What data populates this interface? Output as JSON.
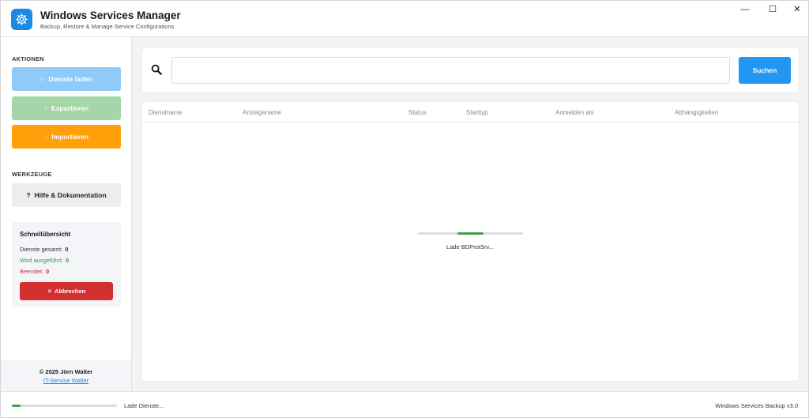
{
  "app": {
    "title": "Windows Services Manager",
    "subtitle": "Backup, Restore & Manage Service Configurations",
    "accent_color": "#1e88e5",
    "icon": "gear-icon"
  },
  "window_controls": {
    "minimize": "—",
    "maximize": "☐",
    "close": "✕"
  },
  "sidebar": {
    "actions_title": "AKTIONEN",
    "actions": [
      {
        "icon": "○",
        "label": "Dienste laden",
        "color": "#90caf9"
      },
      {
        "icon": "↑",
        "label": "Exportieren",
        "color": "#a5d6a7"
      },
      {
        "icon": "↓",
        "label": "Importieren",
        "color": "#ff9f0a"
      }
    ],
    "tools_title": "WERKZEUGE",
    "help": {
      "icon": "?",
      "label": "Hilfe & Dokumentation"
    },
    "summary": {
      "title": "Schnellübersicht",
      "total_label": "Dienste gesamt:",
      "total_value": "0",
      "running_label": "Wird ausgeführt:",
      "running_value": "0",
      "stopped_label": "Beendet:",
      "stopped_value": "0",
      "running_color": "#2e9e3e",
      "stopped_color": "#d32f2f",
      "cancel_icon": "✕",
      "cancel_label": "Abbrechen"
    },
    "footer": {
      "copyright": "© 2025 Jörn Walter",
      "link": "IT-Service Walter"
    }
  },
  "search": {
    "placeholder": "",
    "value": "",
    "button_label": "Suchen"
  },
  "table": {
    "columns": [
      "Dienstname",
      "Anzeigename",
      "Status",
      "Starttyp",
      "Anmelden als",
      "Abhängigkeiten"
    ],
    "rows": [],
    "loading_text": "Lade BDProtSrv...",
    "loading_progress": 0.25
  },
  "statusbar": {
    "text": "Lade Dienste...",
    "progress": 0.08,
    "version": "Windows Services Backup v3.0"
  }
}
